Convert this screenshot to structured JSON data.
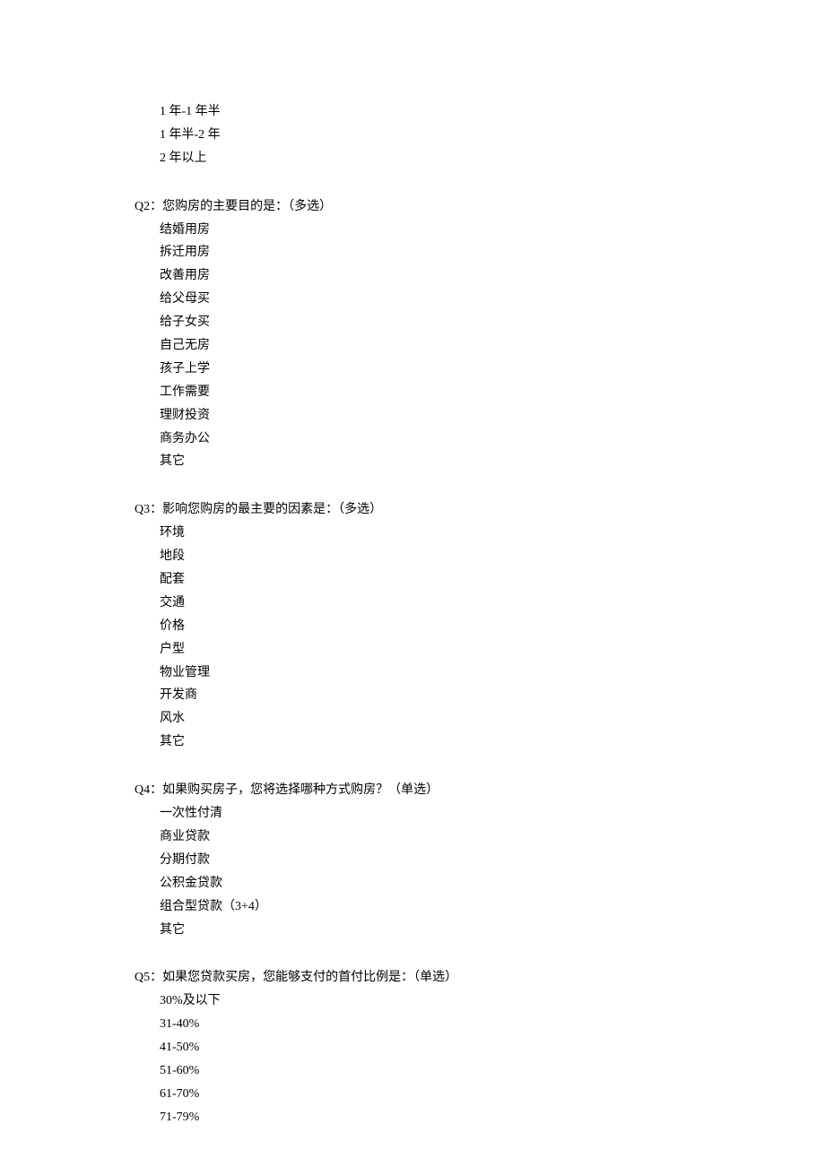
{
  "questions": [
    {
      "label": "",
      "options": [
        "1 年-1 年半",
        "1 年半-2 年",
        "2 年以上"
      ]
    },
    {
      "label": "Q2：您购房的主要目的是：（多选）",
      "options": [
        "结婚用房",
        "拆迁用房",
        "改善用房",
        "给父母买",
        "给子女买",
        "自己无房",
        "孩子上学",
        "工作需要",
        "理财投资",
        "商务办公",
        "其它"
      ]
    },
    {
      "label": "Q3：影响您购房的最主要的因素是：（多选）",
      "options": [
        "环境",
        "地段",
        "配套",
        "交通",
        "价格",
        "户型",
        "物业管理",
        "开发商",
        "风水",
        "其它"
      ]
    },
    {
      "label": "Q4：如果购买房子，您将选择哪种方式购房？（单选）",
      "options": [
        "一次性付清",
        "商业贷款",
        "分期付款",
        "公积金贷款",
        "组合型贷款（3+4）",
        "其它"
      ]
    },
    {
      "label": "Q5：如果您贷款买房，您能够支付的首付比例是：（单选）",
      "options": [
        "30%及以下",
        "31-40%",
        "41-50%",
        "51-60%",
        "61-70%",
        "71-79%"
      ]
    }
  ]
}
